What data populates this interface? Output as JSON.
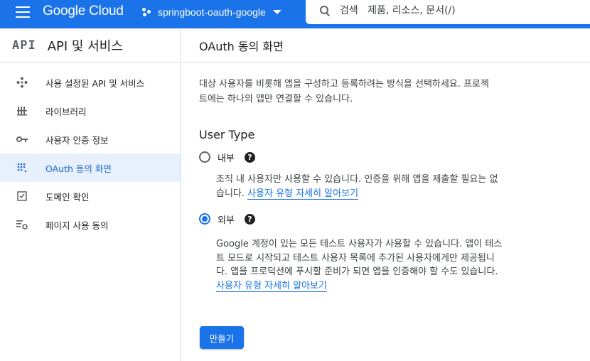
{
  "header": {
    "logo": "Google Cloud",
    "project": "springboot-oauth-google",
    "search_placeholder": "검색   제품, 리소스, 문서(/)"
  },
  "sidebar": {
    "badge": "API",
    "title": "API 및 서비스",
    "items": [
      {
        "label": "사용 설정된 API 및 서비스",
        "icon": "api-services-icon"
      },
      {
        "label": "라이브러리",
        "icon": "library-icon"
      },
      {
        "label": "사용자 인증 정보",
        "icon": "key-icon"
      },
      {
        "label": "OAuth 동의 화면",
        "icon": "oauth-icon",
        "active": true
      },
      {
        "label": "도메인 확인",
        "icon": "domain-check-icon"
      },
      {
        "label": "페이지 사용 동의",
        "icon": "settings-list-icon"
      }
    ]
  },
  "main": {
    "title": "OAuth 동의 화면",
    "description_line1": "대상 사용자를 비롯해 앱을 구성하고 등록하려는 방식을 선택하세요. 프로젝",
    "description_line2": "트에는 하나의 앱만 연결할 수 있습니다.",
    "user_type_title": "User Type",
    "internal": {
      "label": "내부",
      "desc_line1": "조직 내 사용자만 사용할 수 있습니다. 인증을 위해 앱을 제출할 필요는 없",
      "desc_line2_prefix": "습니다. ",
      "link": "사용자 유형 자세히 알아보기",
      "selected": false
    },
    "external": {
      "label": "외부",
      "desc_line1": "Google 계정이 있는 모든 테스트 사용자가 사용할 수 있습니다. 앱이 테스",
      "desc_line2": "트 모드로 시작되고 테스트 사용자 목록에 추가된 사용자에게만 제공됩니",
      "desc_line3": "다. 앱을 프로덕션에 푸시할 준비가 되면 앱을 인증해야 할 수도 있습니다.",
      "link": "사용자 유형 자세히 알아보기",
      "selected": true
    },
    "create_button": "만들기"
  },
  "colors": {
    "accent": "#1a73e8",
    "active_bg": "#e8f0fe"
  }
}
